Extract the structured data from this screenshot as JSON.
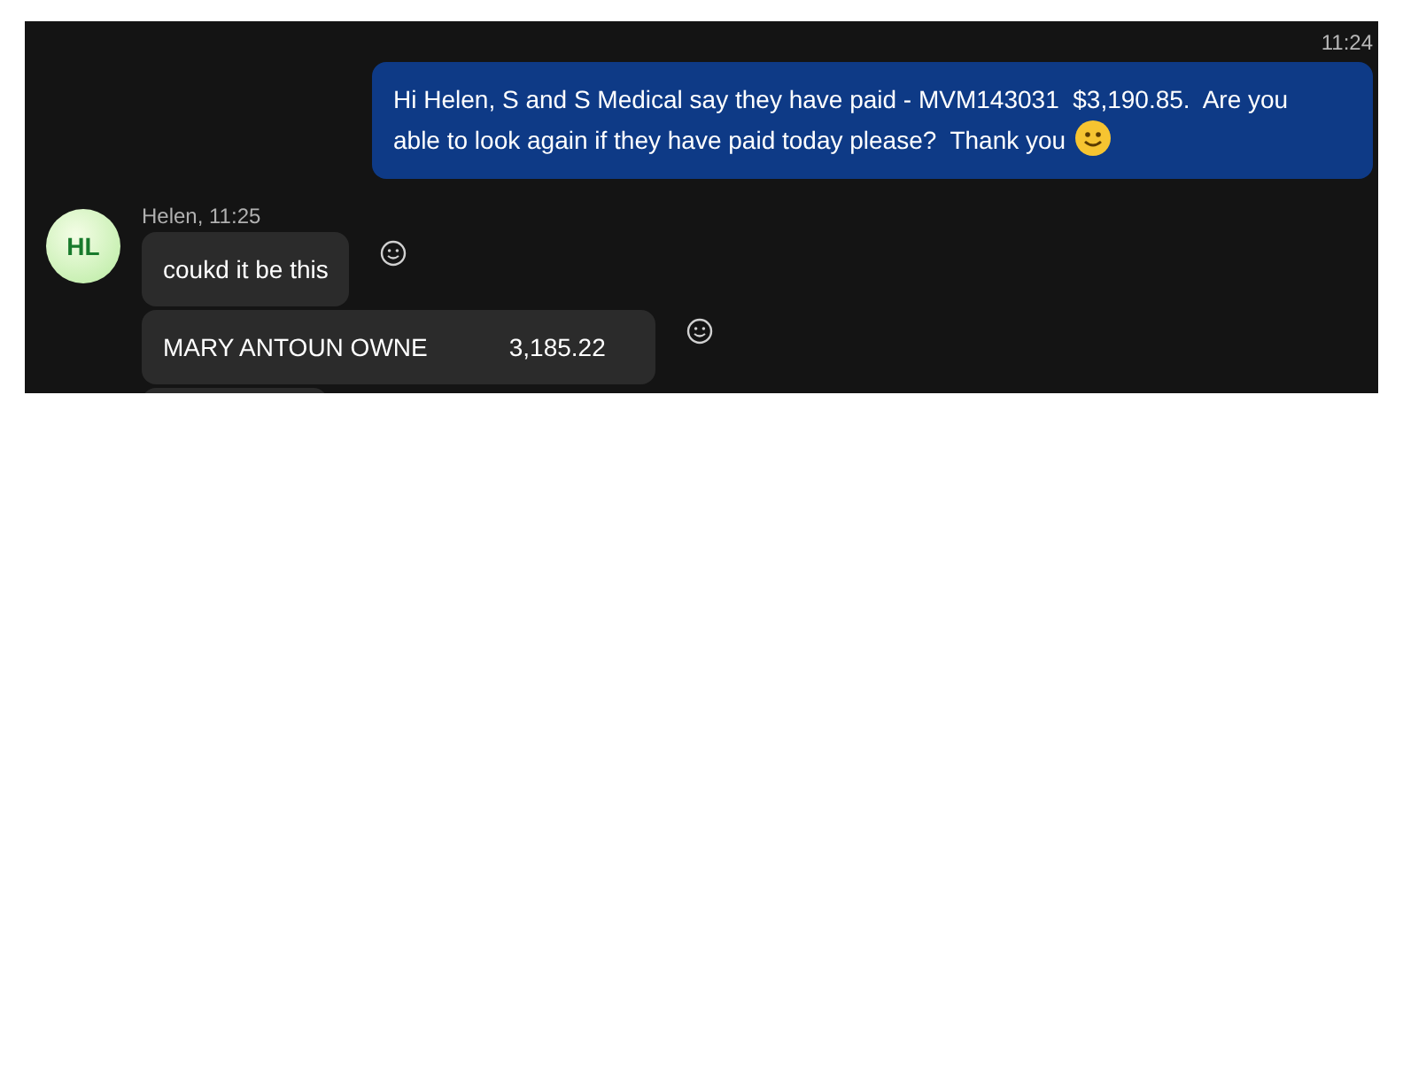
{
  "outgoing": {
    "time": "11:24",
    "text": "Hi Helen, S and S Medical say they have paid - MVM143031  $3,190.85.  Are you able to look again if they have paid today please?  Thank you"
  },
  "incoming": {
    "avatar": "HL",
    "sender": "Helen, 11:25",
    "messages": [
      {
        "kind": "text",
        "text": "coukd it be this"
      },
      {
        "kind": "columns",
        "cells": [
          "MARY ANTOUN OWNE",
          "3,185.22"
        ]
      },
      {
        "kind": "cut"
      }
    ]
  }
}
